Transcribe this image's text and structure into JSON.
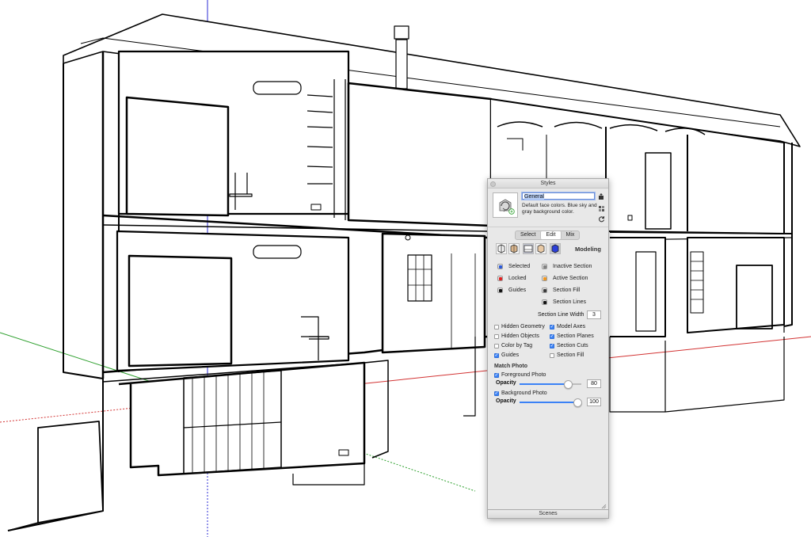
{
  "panel": {
    "title": "Styles",
    "style_name": "General",
    "style_description": "Default face colors. Blue sky and gray background color.",
    "tabs": [
      {
        "label": "Select",
        "active": false
      },
      {
        "label": "Edit",
        "active": true
      },
      {
        "label": "Mix",
        "active": false
      }
    ],
    "section_title": "Modeling",
    "colors_left": [
      {
        "label": "Selected",
        "color": "#2b59d9"
      },
      {
        "label": "Locked",
        "color": "#e02020"
      },
      {
        "label": "Guides",
        "color": "#111111"
      }
    ],
    "colors_right": [
      {
        "label": "Inactive Section",
        "color": "#808080"
      },
      {
        "label": "Active Section",
        "color": "#f0961e"
      },
      {
        "label": "Section Fill",
        "color": "#3a3a3a"
      },
      {
        "label": "Section Lines",
        "color": "#111111"
      }
    ],
    "section_line_width_label": "Section Line Width",
    "section_line_width": "3",
    "checks_left": [
      {
        "label": "Hidden Geometry",
        "checked": false
      },
      {
        "label": "Hidden Objects",
        "checked": false
      },
      {
        "label": "Color by Tag",
        "checked": false
      },
      {
        "label": "Guides",
        "checked": true
      }
    ],
    "checks_right": [
      {
        "label": "Model Axes",
        "checked": true
      },
      {
        "label": "Section Planes",
        "checked": true
      },
      {
        "label": "Section Cuts",
        "checked": true
      },
      {
        "label": "Section Fill",
        "checked": false
      }
    ],
    "match_photo_label": "Match Photo",
    "foreground_photo_label": "Foreground Photo",
    "foreground_checked": true,
    "fg_opacity_label": "Opacity",
    "fg_opacity": "80",
    "background_photo_label": "Background Photo",
    "background_checked": true,
    "bg_opacity_label": "Opacity",
    "bg_opacity": "100"
  },
  "scenes_label": "Scenes",
  "colors": {
    "axis_blue": "#2b2bd6",
    "axis_red": "#d23232",
    "axis_green": "#2ea02e",
    "checkbox_on": "#3b82f6"
  }
}
